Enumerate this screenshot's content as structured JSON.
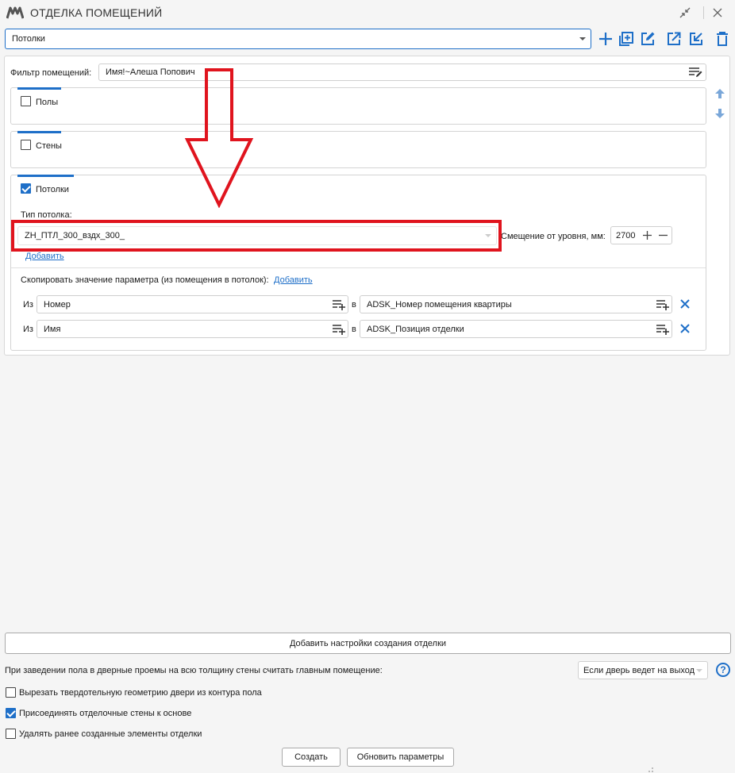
{
  "window": {
    "title": "ОТДЕЛКА ПОМЕЩЕНИЙ",
    "accent_color": "#1e6fc8"
  },
  "preset": {
    "selected": "Потолки"
  },
  "filter": {
    "label": "Фильтр помещений:",
    "value": "Имя!~Алеша Попович"
  },
  "sections": {
    "floors": {
      "label": "Полы",
      "checked": false
    },
    "walls": {
      "label": "Стены",
      "checked": false
    },
    "ceilings": {
      "label": "Потолки",
      "checked": true,
      "type_label": "Тип потолка:",
      "type_value": "ZH_ПТЛ_300_вздх_300_",
      "add_link": "Добавить",
      "offset_label": "Смещение от уровня, мм:",
      "offset_value": "2700",
      "copy_label": "Скопировать значение параметра (из помещения в потолок):",
      "copy_add_link": "Добавить",
      "mappings": [
        {
          "from_label": "Из",
          "from": "Номер",
          "to_label": "в",
          "to": "ADSK_Номер помещения квартиры"
        },
        {
          "from_label": "Из",
          "from": "Имя",
          "to_label": "в",
          "to": "ADSK_Позиция отделки"
        }
      ]
    }
  },
  "footer": {
    "add_settings_button": "Добавить настройки создания отделки",
    "door_rule_label": "При заведении пола в дверные проемы на всю толщину стены считать главным помещение:",
    "door_rule_value": "Если дверь ведет на выход",
    "options": [
      {
        "label": "Вырезать твердотельную геометрию двери из контура пола",
        "checked": false
      },
      {
        "label": "Присоединять отделочные стены к основе",
        "checked": true
      },
      {
        "label": "Удалять ранее созданные элементы отделки",
        "checked": false
      }
    ],
    "create_button": "Создать",
    "update_button": "Обновить параметры"
  },
  "annotation": {
    "highlight_color": "#e0141e"
  }
}
